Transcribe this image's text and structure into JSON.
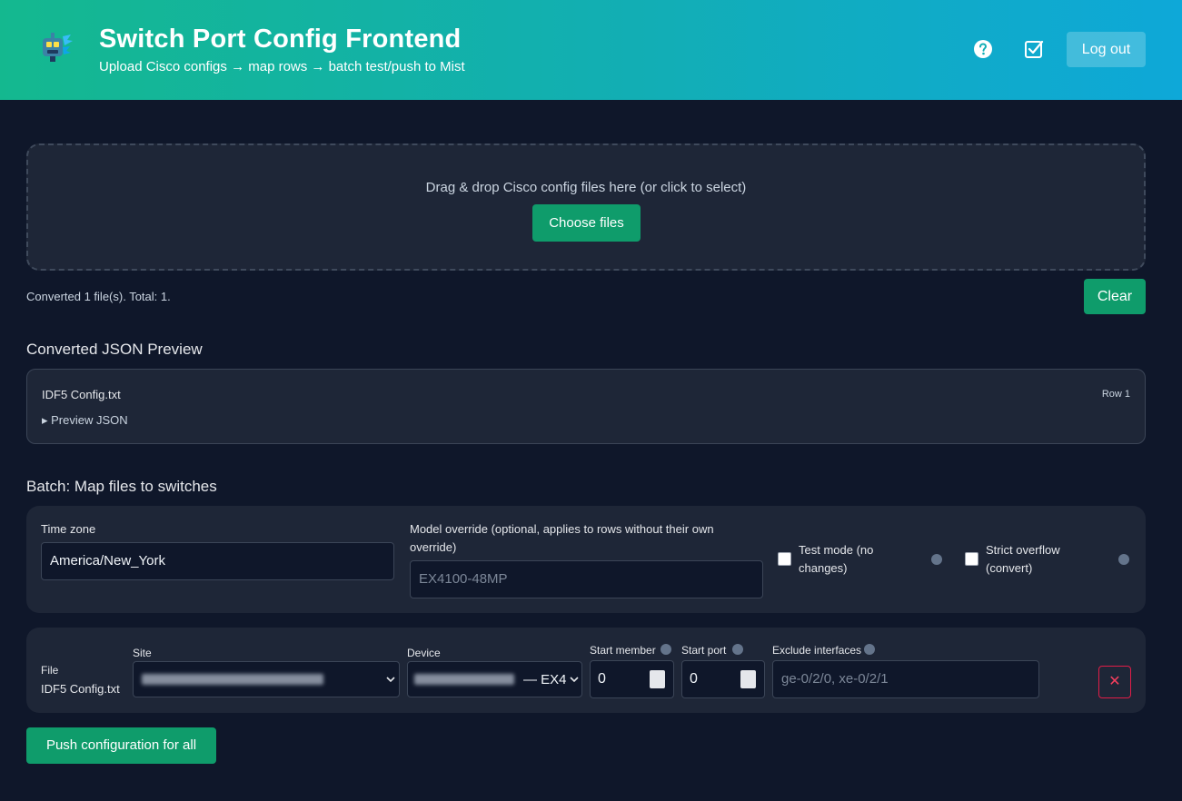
{
  "header": {
    "title": "Switch Port Config Frontend",
    "subtitle": "Upload Cisco configs → map rows → batch test/push to Mist",
    "logout_label": "Log out",
    "icons": [
      "logo-icon",
      "help-icon",
      "checkbox-icon"
    ],
    "gradient_colors": [
      "#14b88f",
      "#0ea8d8"
    ]
  },
  "upload": {
    "dropzone_text": "Drag & drop Cisco config files here (or click to select)",
    "choose_label": "Choose files",
    "status": "Converted 1 file(s). Total: 1.",
    "clear_label": "Clear"
  },
  "preview": {
    "title": "Converted JSON Preview",
    "file_name": "IDF5 Config.txt",
    "row_label": "Row 1",
    "toggle_label": "▸ Preview JSON"
  },
  "batch": {
    "title": "Batch: Map files to switches",
    "timezone_label": "Time zone",
    "timezone_value": "America/New_York",
    "model_label": "Model override (optional, applies to rows without their own override)",
    "model_placeholder": "EX4100-48MP",
    "test_mode_label": "Test mode (no changes)",
    "test_mode_checked": false,
    "strict_label": "Strict overflow (convert)",
    "strict_checked": false
  },
  "row": {
    "file_label": "File",
    "file_name": "IDF5 Config.txt",
    "site_label": "Site",
    "device_label": "Device",
    "device_suffix": "— EX4",
    "start_member_label": "Start member",
    "start_member_value": "0",
    "start_port_label": "Start port",
    "start_port_value": "0",
    "exclude_label": "Exclude interfaces",
    "exclude_placeholder": "ge-0/2/0, xe-0/2/1",
    "remove_label": "✕"
  },
  "actions": {
    "push_all_label": "Push configuration for all"
  },
  "colors": {
    "accent": "#0f9c6b",
    "background": "#0f172a",
    "card": "#1e2637",
    "danger": "#e11d48"
  }
}
